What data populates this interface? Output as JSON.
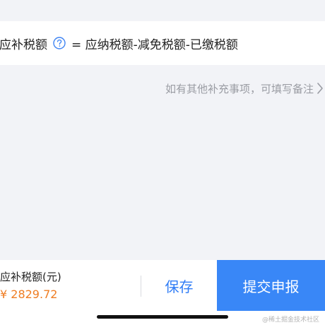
{
  "formula": {
    "label": "应补税额",
    "help_icon": "question-circle-icon",
    "expression": "= 应纳税额-减免税额-已缴税额"
  },
  "note": {
    "text": "如有其他补充事项，可填写备注",
    "chevron_icon": "chevron-right-icon"
  },
  "bottom_bar": {
    "amount_label": "应补税额(元)",
    "amount_value": "¥ 2829.72",
    "save_label": "保存",
    "submit_label": "提交申报"
  },
  "watermark": "@稀土掘金技术社区",
  "colors": {
    "accent": "#3987f7",
    "amount": "#ef7d23",
    "muted_text": "#9a9ca3"
  }
}
